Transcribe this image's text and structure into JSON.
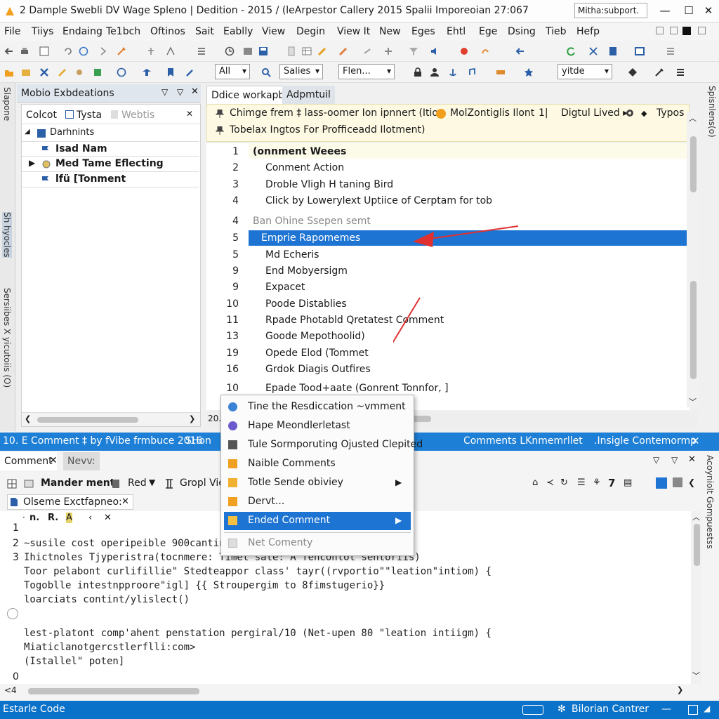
{
  "window": {
    "title": "2 Dample Swebli DV Wage Spleno | Dedition - 2015 / (leArpestor Callery 2015 Spalii Imporeoian 27:067",
    "account": "Mitha:subport.",
    "min": "—",
    "max": "☐",
    "close": "✕"
  },
  "menu": [
    "File",
    "Tiiys",
    "Endaing",
    "Te1bch",
    "Oftinos",
    "Sait",
    "Eablly",
    "View",
    "Degin",
    "View It",
    "New",
    "Eges",
    "Ehtl",
    "Ege",
    "Dsing",
    "Tieb",
    "Hefp"
  ],
  "toolbar": {
    "combo1": "All",
    "combo2": "Salies",
    "combo3": "Flen...",
    "combo4": "yitde"
  },
  "left_panel": {
    "title": "Mobio Exbdeations",
    "vtab1": "Slapone",
    "vtab2": "Sh hyocles",
    "vtab3": "Sersiibes X yicutoiis (O)",
    "subtab1": "Colcot",
    "subtab2": "Tysta",
    "subtab3": "Webtis",
    "tree": [
      {
        "label": "Darhnints"
      },
      {
        "label": "Isad Nam"
      },
      {
        "label": "Med Tame Eflecting"
      },
      {
        "label": "lfü [Tonment"
      }
    ]
  },
  "editor": {
    "tab_active": "Ddice workapbs",
    "tab_other": "Adpmtuil",
    "info_line1": "Chimge frem ‡ lass-oomer Ion ipnnert (Ition",
    "info_line1b": "MolZontiglis Ilont",
    "info_line1c": "1|",
    "info_line1d": "Digtul Lived ▸",
    "info_line1e": "Typos",
    "info_line2": "Tobelax Ingtos For Profficeadd Ilotment)",
    "lines": [
      {
        "n": "1",
        "text": "(onnment Weees"
      },
      {
        "n": "2",
        "text": "Conment Action"
      },
      {
        "n": "3",
        "text": "Droble Vligh H taning Bird"
      },
      {
        "n": "4",
        "text": "Click by Lowerylext Uptiice of Cerptam for tob"
      },
      {
        "n": "4",
        "text": "Ban Ohine Ssepen semt"
      },
      {
        "n": "5",
        "text": "Emprie Rapomemes"
      },
      {
        "n": "5",
        "text": "Md Echeris"
      },
      {
        "n": "9",
        "text": "End Mobyersigm"
      },
      {
        "n": "9",
        "text": "Expacet"
      },
      {
        "n": "10",
        "text": "Poode Distablies"
      },
      {
        "n": "11",
        "text": "Rpade Photabld Qretatest Comment"
      },
      {
        "n": "13",
        "text": "Goode Mepothoolid)"
      },
      {
        "n": "19",
        "text": "Opede Elod (Tommet"
      },
      {
        "n": "16",
        "text": "Grdok Diagis Outfires"
      },
      {
        "n": "10",
        "text": "Epade Tood+aate (Gonrent Tonnfor, ]"
      }
    ],
    "zoom": "20."
  },
  "band": {
    "left": "10. E Comment  ‡ by fVibe frmbuce 2016",
    "mid": "SHon",
    "right1": "Comments LKnmemrllet",
    "right2": ".Insigle Contemormp"
  },
  "bottom": {
    "tab1": "Comment",
    "tab2": "Nevv:",
    "tool1": "Mander ment",
    "tool2": "Red",
    "tool3": "Gropl Vie",
    "file_tab": "Olsemе Exctfapneo:",
    "mini1": "n.",
    "mini2": "R.",
    "lines": [
      {
        "n": "1",
        "text": ""
      },
      {
        "n": "2",
        "text": "~susile cost operipeible 900cantina"
      },
      {
        "n": "3",
        "text": "Ihictnoles Tjyperistra(tocnmere: Timet sate: A Tencontot sentoriis)"
      },
      {
        "n": "",
        "text": "Toor pelabont curlifillie\" Stedteappor class' tayr((rvportio\"\"leation\"intiom) {"
      },
      {
        "n": "",
        "text": "Togoblle intestnpproore\"igl] {{ Stroupergim to 8fimstugerio}}"
      },
      {
        "n": "",
        "text": "loarciats contint/ylislect()"
      },
      {
        "n": "",
        "text": "lest-platont comp'ahent penstation pergiral/10 (Net-upen 80 \"leation intiigm) {"
      },
      {
        "n": "",
        "text": "Miaticlanotgercstlerflli:com>"
      },
      {
        "n": "",
        "text": "(Istallel\" poten]"
      },
      {
        "n": "0",
        "text": ""
      }
    ],
    "right_v1": "Acoyniolt Gompuestss",
    "right_v2": "Spisnlens(o)",
    "zoom": "<4"
  },
  "context_menu": [
    {
      "label": "Tine the Resdiccation ~vmment",
      "icon": "refresh-icon",
      "color": "#3b82d6"
    },
    {
      "label": "Hape Meondlerletast",
      "icon": "globe-icon",
      "color": "#6a5acd"
    },
    {
      "label": "Tule Sormporuting Ojusted Clepited",
      "icon": "db-icon",
      "color": "#555"
    },
    {
      "label": "Naible Comments",
      "icon": "flag-icon",
      "color": "#f0a020"
    },
    {
      "label": "Totle Sende obiviey",
      "icon": "folder-icon",
      "color": "#f0b030",
      "arrow": "▶"
    },
    {
      "label": "Dervt...",
      "icon": "flag-icon",
      "color": "#f0a020"
    },
    {
      "label": "Ended Comment",
      "icon": "comment-icon",
      "color": "#f5c040",
      "arrow": "▶"
    },
    {
      "label": "Net Comenty",
      "icon": "note-icon",
      "color": "#bbb"
    }
  ],
  "status": {
    "left": "Estarle Code",
    "right": "Bilorian Cantrer"
  },
  "colors": {
    "accent": "#0a72c9",
    "selection": "#1e74d3",
    "arrow": "#e03030"
  }
}
